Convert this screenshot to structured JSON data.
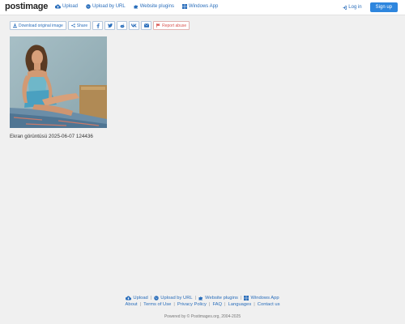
{
  "navbar": {
    "logo_post": "post",
    "logo_image": "image",
    "links": [
      {
        "label": "Upload",
        "icon": "cloud-upload-icon"
      },
      {
        "label": "Upload by URL",
        "icon": "globe-icon"
      },
      {
        "label": "Website plugins",
        "icon": "puzzle-icon"
      },
      {
        "label": "Windows App",
        "icon": "windows-icon"
      }
    ],
    "login_label": "Log in",
    "signup_label": "Sign up"
  },
  "toolbar": {
    "download_label": "Download original image",
    "share_label": "Share",
    "report_label": "Report abuse",
    "icons": [
      "facebook-icon",
      "twitter-icon",
      "reddit-icon",
      "vk-icon",
      "email-icon"
    ]
  },
  "image": {
    "caption": "Ekran görüntüsü 2025-06-07 124436"
  },
  "footer": {
    "row1": [
      {
        "label": "Upload",
        "icon": "cloud-upload-icon"
      },
      {
        "label": "Upload by URL",
        "icon": "globe-icon"
      },
      {
        "label": "Website plugins",
        "icon": "puzzle-icon"
      },
      {
        "label": "Windows App",
        "icon": "windows-icon"
      }
    ],
    "row2": [
      "About",
      "Terms of Use",
      "Privacy Policy",
      "FAQ",
      "Languages",
      "Contact us"
    ],
    "copyright": "Powered by © Postimages.org, 2004-2025"
  },
  "colors": {
    "link": "#2a6ebb",
    "signup_bg": "#2e86de",
    "report": "#d9534f",
    "background": "#f0f0f0"
  }
}
